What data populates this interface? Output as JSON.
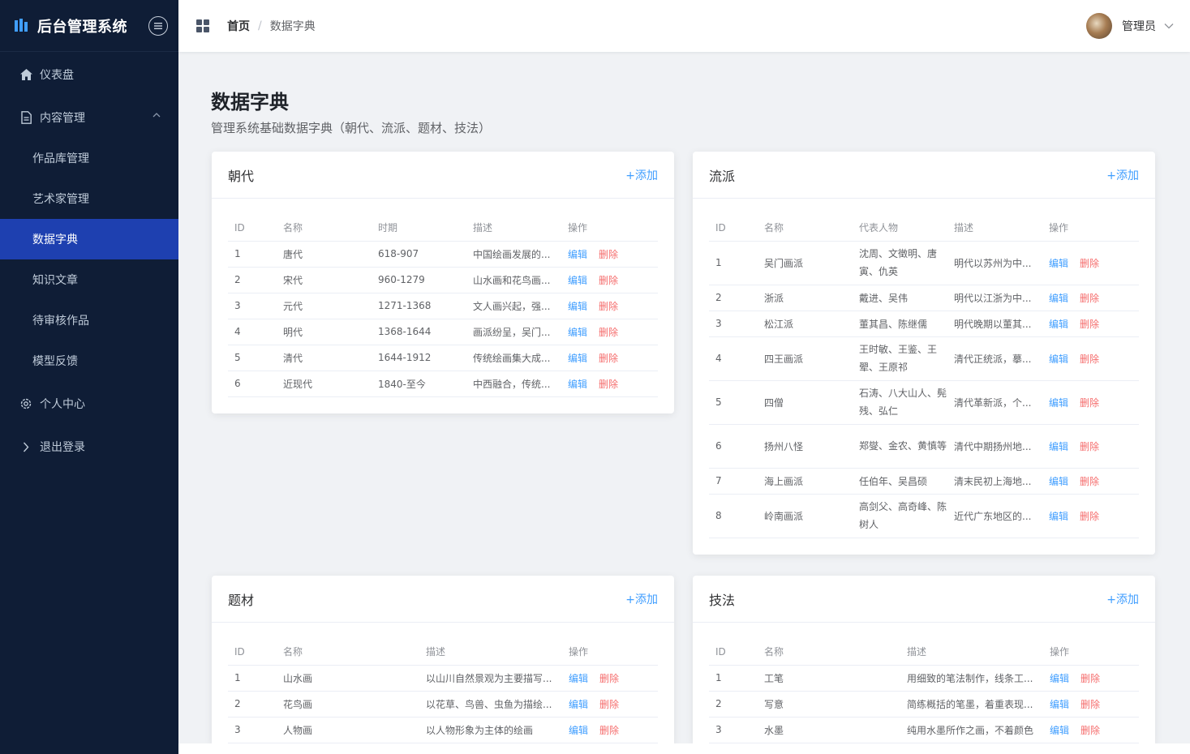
{
  "brand": {
    "title": "后台管理系统"
  },
  "sidebar": {
    "items": [
      {
        "label": "仪表盘",
        "icon": "home-icon"
      },
      {
        "label": "内容管理",
        "icon": "document-icon"
      },
      {
        "label": "作品库管理"
      },
      {
        "label": "艺术家管理"
      },
      {
        "label": "数据字典"
      },
      {
        "label": "知识文章"
      },
      {
        "label": "待审核作品"
      },
      {
        "label": "模型反馈"
      },
      {
        "label": "个人中心",
        "icon": "gear-icon"
      },
      {
        "label": "退出登录",
        "icon": "chevron-right-icon"
      }
    ]
  },
  "header": {
    "breadcrumb": {
      "home": "首页",
      "sep": "/",
      "current": "数据字典"
    },
    "user": "管理员"
  },
  "page": {
    "title": "数据字典",
    "desc": "管理系统基础数据字典（朝代、流派、题材、技法）"
  },
  "actions": {
    "add": "+添加",
    "edit": "编辑",
    "delete": "删除"
  },
  "dynasty": {
    "title": "朝代",
    "columns": [
      "ID",
      "名称",
      "时期",
      "描述",
      "操作"
    ],
    "rows": [
      [
        "1",
        "唐代",
        "618-907",
        "中国绘画发展的..."
      ],
      [
        "2",
        "宋代",
        "960-1279",
        "山水画和花鸟画..."
      ],
      [
        "3",
        "元代",
        "1271-1368",
        "文人画兴起，强..."
      ],
      [
        "4",
        "明代",
        "1368-1644",
        "画派纷呈，吴门..."
      ],
      [
        "5",
        "清代",
        "1644-1912",
        "传统绘画集大成..."
      ],
      [
        "6",
        "近现代",
        "1840-至今",
        "中西融合，传统..."
      ]
    ]
  },
  "school": {
    "title": "流派",
    "columns": [
      "ID",
      "名称",
      "代表人物",
      "描述",
      "操作"
    ],
    "rows": [
      [
        "1",
        "吴门画派",
        "沈周、文徵明、唐寅、仇英",
        "明代以苏州为中..."
      ],
      [
        "2",
        "浙派",
        "戴进、吴伟",
        "明代以江浙为中..."
      ],
      [
        "3",
        "松江派",
        "董其昌、陈继儒",
        "明代晚期以董其..."
      ],
      [
        "4",
        "四王画派",
        "王时敏、王鉴、王翚、王原祁",
        "清代正统派，摹..."
      ],
      [
        "5",
        "四僧",
        "石涛、八大山人、髡残、弘仁",
        "清代革新派，个..."
      ],
      [
        "6",
        "扬州八怪",
        "郑燮、金农、黄慎等",
        "清代中期扬州地..."
      ],
      [
        "7",
        "海上画派",
        "任伯年、吴昌硕",
        "清末民初上海地..."
      ],
      [
        "8",
        "岭南画派",
        "高剑父、高奇峰、陈树人",
        "近代广东地区的..."
      ]
    ]
  },
  "subject": {
    "title": "题材",
    "columns": [
      "ID",
      "名称",
      "描述",
      "操作"
    ],
    "rows": [
      [
        "1",
        "山水画",
        "以山川自然景观为主要描写..."
      ],
      [
        "2",
        "花鸟画",
        "以花草、鸟兽、虫鱼为描绘..."
      ],
      [
        "3",
        "人物画",
        "以人物形象为主体的绘画"
      ]
    ]
  },
  "technique": {
    "title": "技法",
    "columns": [
      "ID",
      "名称",
      "描述",
      "操作"
    ],
    "rows": [
      [
        "1",
        "工笔",
        "用细致的笔法制作，线条工..."
      ],
      [
        "2",
        "写意",
        "简练概括的笔墨，着重表现..."
      ],
      [
        "3",
        "水墨",
        "纯用水墨所作之画，不着颜色"
      ]
    ]
  }
}
